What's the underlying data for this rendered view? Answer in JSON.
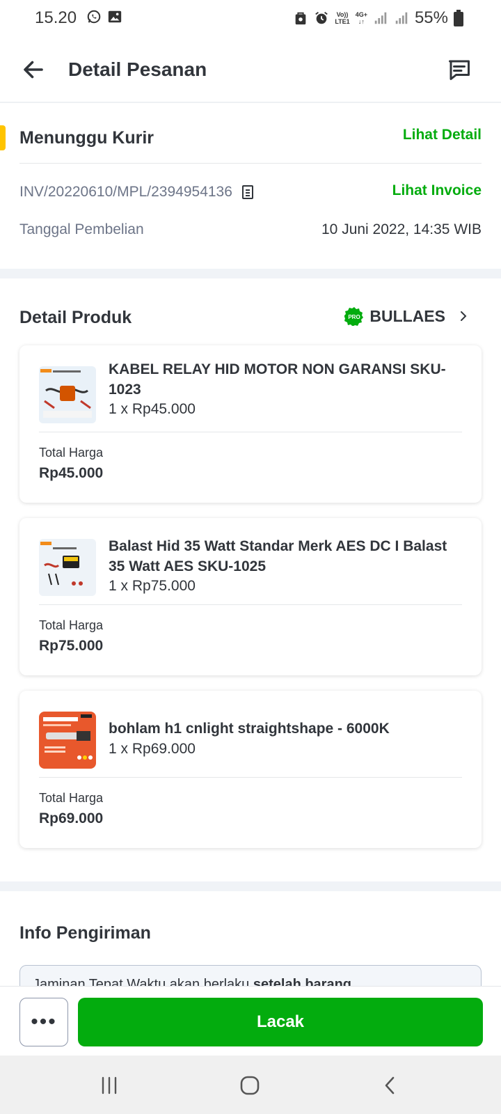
{
  "status_bar": {
    "time": "15.20",
    "signal_top": "Vo))",
    "signal_bottom": "LTE1",
    "net": "4G+",
    "battery": "55%"
  },
  "header": {
    "title": "Detail Pesanan"
  },
  "order_status": {
    "title": "Menunggu Kurir",
    "detail_link": "Lihat Detail",
    "invoice_number": "INV/20220610/MPL/2394954136",
    "invoice_link": "Lihat Invoice",
    "purchase_label": "Tanggal Pembelian",
    "purchase_date": "10 Juni 2022, 14:35 WIB"
  },
  "products": {
    "title": "Detail Produk",
    "shop_badge": "PRO",
    "shop_name": "BULLAES",
    "items": [
      {
        "name": "KABEL RELAY HID MOTOR NON GARANSI SKU-1023",
        "qty": "1 x Rp45.000",
        "total_label": "Total Harga",
        "total": "Rp45.000"
      },
      {
        "name": "Balast Hid 35 Watt Standar Merk AES DC I Balast 35 Watt AES SKU-1025",
        "qty": "1 x Rp75.000",
        "total_label": "Total Harga",
        "total": "Rp75.000"
      },
      {
        "name": "bohlam h1 cnlight straightshape - 6000K",
        "qty": "1 x Rp69.000",
        "total_label": "Total Harga",
        "total": "Rp69.000"
      }
    ]
  },
  "shipping": {
    "title": "Info Pengiriman",
    "notice_start": "Jaminan Tepat Waktu akan berlaku ",
    "notice_bold": "setelah barang"
  },
  "actions": {
    "more": "•••",
    "primary": "Lacak"
  },
  "colors": {
    "accent_green": "#03ac0e",
    "status_yellow": "#ffc400"
  }
}
